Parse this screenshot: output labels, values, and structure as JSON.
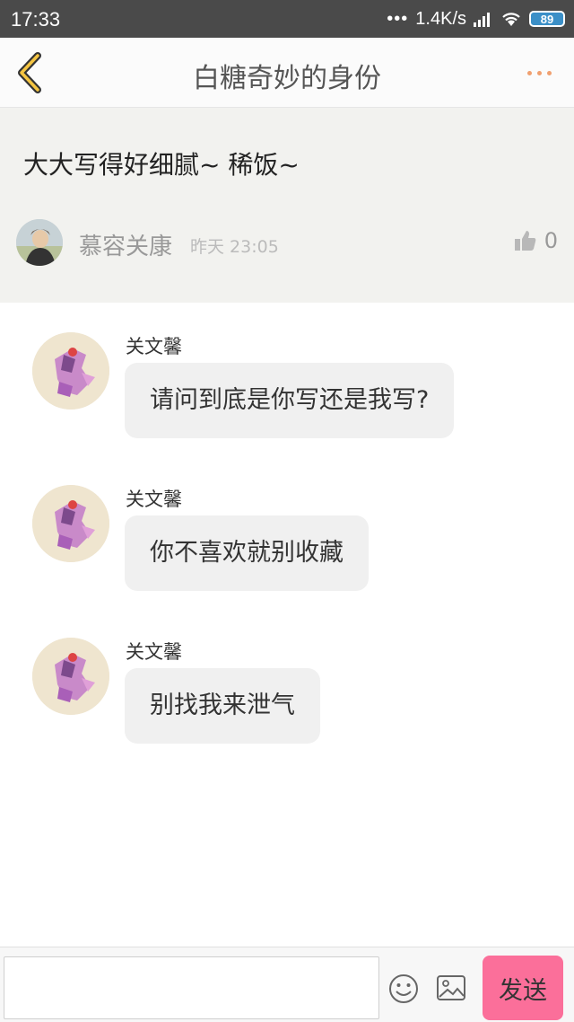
{
  "status_bar": {
    "time": "17:33",
    "network_speed": "1.4K/s",
    "battery": "89",
    "icons": [
      "dots-icon",
      "signal-icon",
      "wifi-icon",
      "battery-icon"
    ]
  },
  "header": {
    "title": "白糖奇妙的身份",
    "back_icon": "chevron-left-icon",
    "more_icon": "more-dots-icon",
    "accent_color": "#f5a623"
  },
  "original_comment": {
    "text": "大大写得好细腻~ 稀饭~",
    "author": "慕容关康",
    "time": "昨天 23:05",
    "like_icon": "thumbs-up-icon",
    "like_count": "0"
  },
  "replies": [
    {
      "name": "关文馨",
      "text": "请问到底是你写还是我写?"
    },
    {
      "name": "关文馨",
      "text": "你不喜欢就别收藏"
    },
    {
      "name": "关文馨",
      "text": "别找我来泄气"
    }
  ],
  "input_bar": {
    "placeholder": "",
    "emoji_icon": "smiley-icon",
    "image_icon": "image-icon",
    "send_label": "发送",
    "send_color": "#fb6f9a"
  }
}
